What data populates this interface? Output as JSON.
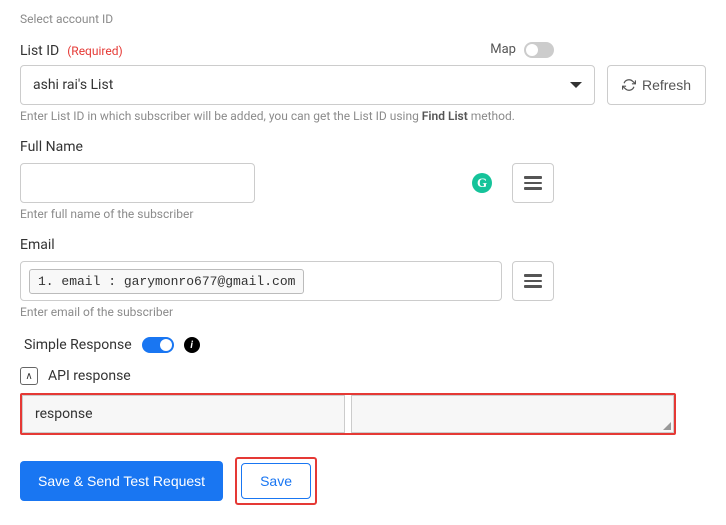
{
  "top_hint": "Select account ID",
  "list": {
    "label": "List ID",
    "required_label": "(Required)",
    "map_label": "Map",
    "selected": "ashi rai's List",
    "refresh_label": "Refresh",
    "hint_prefix": "Enter List ID in which subscriber will be added, you can get the List ID using ",
    "hint_strong": "Find List",
    "hint_suffix": " method."
  },
  "fullname": {
    "label": "Full Name",
    "value": "",
    "hint": "Enter full name of the subscriber"
  },
  "email": {
    "label": "Email",
    "chip": "1. email : garymonro677@gmail.com",
    "hint": "Enter email of the subscriber"
  },
  "simple_response": {
    "label": "Simple Response"
  },
  "api": {
    "label": "API response",
    "response_label": "response"
  },
  "buttons": {
    "save_send": "Save & Send Test Request",
    "save": "Save"
  },
  "icons": {
    "grammarly": "G",
    "info": "i",
    "collapse": "∧"
  }
}
